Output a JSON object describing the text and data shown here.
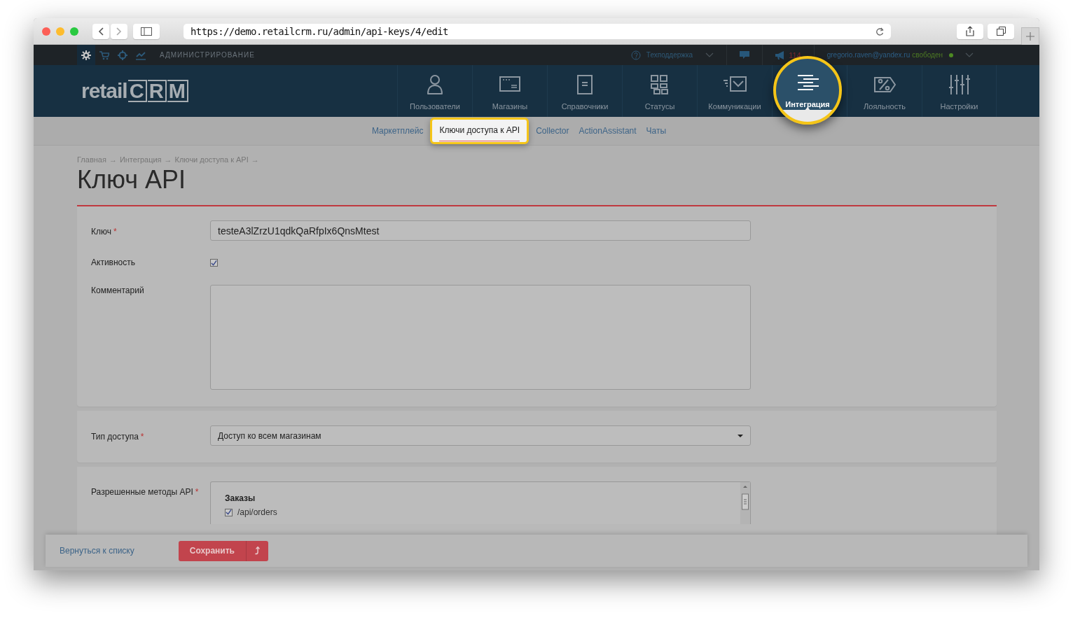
{
  "browser": {
    "url": "https://demo.retailcrm.ru/admin/api-keys/4/edit"
  },
  "topbar": {
    "sections": [
      {
        "selected": true
      },
      {
        "selected": false
      },
      {
        "selected": false
      },
      {
        "selected": false
      }
    ],
    "section_title": "АДМИНИСТРИРОВАНИЕ",
    "support": "Техподдержка",
    "notifications": "114",
    "user_email": "gregorio.raven@yandex.ru",
    "user_status": "свободен"
  },
  "nav": {
    "logo": {
      "word": "retail",
      "letters": [
        "C",
        "R",
        "M"
      ]
    },
    "items": [
      {
        "label": "Пользователи",
        "selected": false
      },
      {
        "label": "Магазины",
        "selected": false
      },
      {
        "label": "Справочники",
        "selected": false
      },
      {
        "label": "Статусы",
        "selected": false
      },
      {
        "label": "Коммуникации",
        "selected": false
      },
      {
        "label": "Интеграция",
        "selected": true
      },
      {
        "label": "Лояльность",
        "selected": false
      },
      {
        "label": "Настройки",
        "selected": false
      }
    ]
  },
  "subnav": [
    {
      "label": "Маркетплейс",
      "selected": false
    },
    {
      "label": "Ключи доступа к API",
      "selected": true
    },
    {
      "label": "Collector",
      "selected": false
    },
    {
      "label": "ActionAssistant",
      "selected": false
    },
    {
      "label": "Чаты",
      "selected": false
    }
  ],
  "breadcrumbs": [
    {
      "label": "Главная",
      "separator": "→"
    },
    {
      "label": "Интеграция",
      "separator": "→"
    },
    {
      "label": "Ключи доступа к API",
      "separator": "→"
    }
  ],
  "title": "Ключ API",
  "cards": [
    {
      "fields": [
        {
          "kind": "text",
          "label": "Ключ",
          "required_mark": "*",
          "value": "testeA3lZrzU1qdkQaRfpIx6QnsMtest"
        },
        {
          "kind": "checkbox",
          "label": "Активность",
          "checked": true
        },
        {
          "kind": "textarea",
          "label": "Комментарий"
        }
      ]
    },
    {
      "fields": [
        {
          "kind": "select",
          "label": "Тип доступа",
          "required_mark": "*",
          "value": "Доступ ко всем магазинам"
        }
      ]
    },
    {
      "fields": [
        {
          "kind": "methods",
          "label": "Разрешенные методы API",
          "required_mark": "*",
          "group": "Заказы",
          "methods": [
            {
              "label": "/api/orders",
              "checked": true
            }
          ]
        }
      ]
    }
  ],
  "footer": {
    "back_link": "Вернуться к списку",
    "save": "Сохранить",
    "save_more": "⤴"
  }
}
